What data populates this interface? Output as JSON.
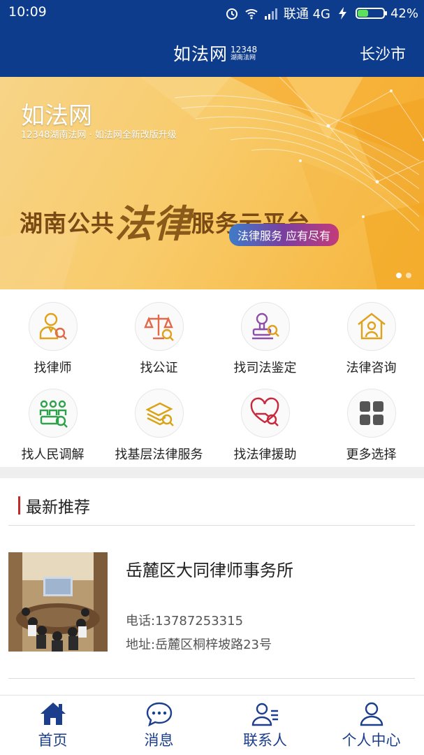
{
  "status_bar": {
    "time": "10:09",
    "carrier": "联通 4G",
    "battery": "42%",
    "battery_level": 0.42
  },
  "header": {
    "logo_text": "如法网",
    "logo_number": "12348",
    "logo_sub": "湖南法网",
    "city": "长沙市"
  },
  "banner": {
    "logo": "如法网",
    "caption": "12348湖南法网 · 如法网全新改版升级",
    "title_pre": "湖南公共",
    "title_big": "法律",
    "title_post": "服务云平台",
    "pill": "法律服务  应有尽有",
    "colors": {
      "accent": "#f6b43a",
      "text": "#7a4a14"
    }
  },
  "services": [
    {
      "label": "找律师",
      "icon": "lawyer-icon",
      "color": "#e0a11b"
    },
    {
      "label": "找公证",
      "icon": "scales-icon",
      "color": "#e06a4a"
    },
    {
      "label": "找司法鉴定",
      "icon": "stamp-icon",
      "color": "#8e4fa6"
    },
    {
      "label": "法律咨询",
      "icon": "house-person-icon",
      "color": "#e0a11b"
    },
    {
      "label": "找人民调解",
      "icon": "people-icon",
      "color": "#2ea24a"
    },
    {
      "label": "找基层法律服务",
      "icon": "documents-icon",
      "color": "#d9a317"
    },
    {
      "label": "找法律援助",
      "icon": "heart-hand-icon",
      "color": "#c8283a"
    },
    {
      "label": "更多选择",
      "icon": "more-grid-icon",
      "color": "#555555"
    }
  ],
  "section": {
    "title": "最新推荐"
  },
  "recommend": {
    "name": "岳麓区大同律师事务所",
    "phone": "电话:13787253315",
    "address": "地址:岳麓区桐梓坡路23号"
  },
  "nav": [
    {
      "label": "首页",
      "icon": "home-icon"
    },
    {
      "label": "消息",
      "icon": "message-icon"
    },
    {
      "label": "联系人",
      "icon": "contacts-icon"
    },
    {
      "label": "个人中心",
      "icon": "profile-icon"
    }
  ]
}
